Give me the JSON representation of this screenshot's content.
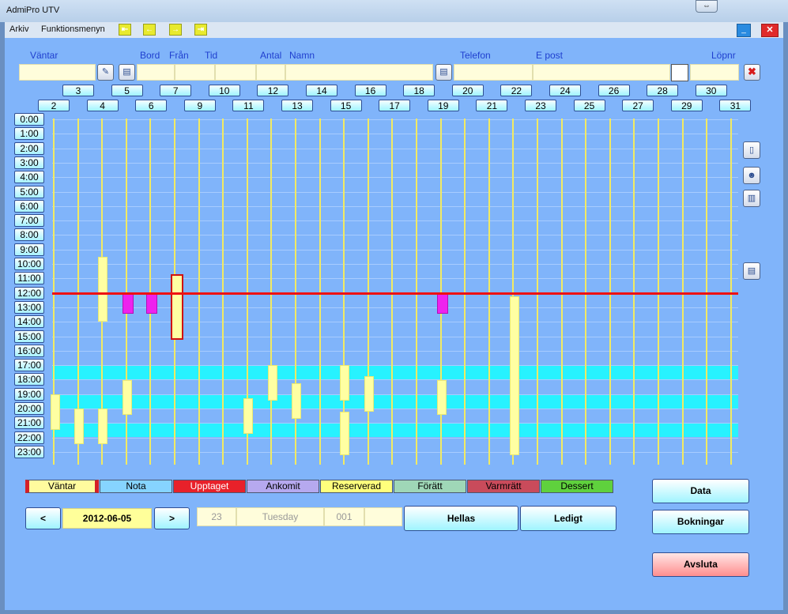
{
  "window": {
    "title": "AdmiPro UTV",
    "restore_label": "⇔",
    "minimize_label": "_",
    "close_label": "✕"
  },
  "menu": {
    "items": [
      "Arkiv",
      "Funktionsmenyn"
    ],
    "nav_arrows": [
      "⇤",
      "←",
      "→",
      "⇥"
    ]
  },
  "form": {
    "headers": {
      "vantar": "Väntar",
      "bord": "Bord",
      "fran": "Från",
      "tid": "Tid",
      "antal": "Antal",
      "namn": "Namn",
      "telefon": "Telefon",
      "epost": "E post",
      "lopnr": "Löpnr"
    },
    "delete_icon": "✖"
  },
  "days": {
    "odd": [
      "3",
      "5",
      "7",
      "10",
      "12",
      "14",
      "16",
      "18",
      "20",
      "22",
      "24",
      "26",
      "28",
      "30"
    ],
    "even": [
      "2",
      "4",
      "6",
      "9",
      "11",
      "13",
      "15",
      "17",
      "19",
      "21",
      "23",
      "25",
      "27",
      "29",
      "31"
    ]
  },
  "hours": [
    "0:00",
    "1:00",
    "2:00",
    "3:00",
    "4:00",
    "5:00",
    "6:00",
    "7:00",
    "8:00",
    "9:00",
    "10:00",
    "11:00",
    "12:00",
    "13:00",
    "14:00",
    "15:00",
    "16:00",
    "17:00",
    "18:00",
    "19:00",
    "20:00",
    "21:00",
    "22:00",
    "23:00"
  ],
  "legend": [
    {
      "label": "Väntar",
      "color": "#fffb9e"
    },
    {
      "label": "Nota",
      "color": "#86d4ff"
    },
    {
      "label": "Upptaget",
      "color": "#e8212a"
    },
    {
      "label": "Ankomit",
      "color": "#b6a9ef"
    },
    {
      "label": "Reserverad",
      "color": "#ffff7c"
    },
    {
      "label": "Förätt",
      "color": "#9fd7b7"
    },
    {
      "label": "Varmrätt",
      "color": "#c94b5b"
    },
    {
      "label": "Dessert",
      "color": "#5fd13d"
    }
  ],
  "bottom": {
    "prev_label": "<",
    "next_label": ">",
    "date": "2012-06-05",
    "day_num": "23",
    "weekday": "Tuesday",
    "code": "001",
    "hellas_label": "Hellas",
    "ledigt_label": "Ledigt",
    "data_label": "Data",
    "bokningar_label": "Bokningar",
    "avsluta_label": "Avsluta"
  },
  "colors": {
    "current_time_line": "#ee1111",
    "band": "#27f2ff",
    "booking": "#ffffa2",
    "magenta": "#ee22ee"
  }
}
